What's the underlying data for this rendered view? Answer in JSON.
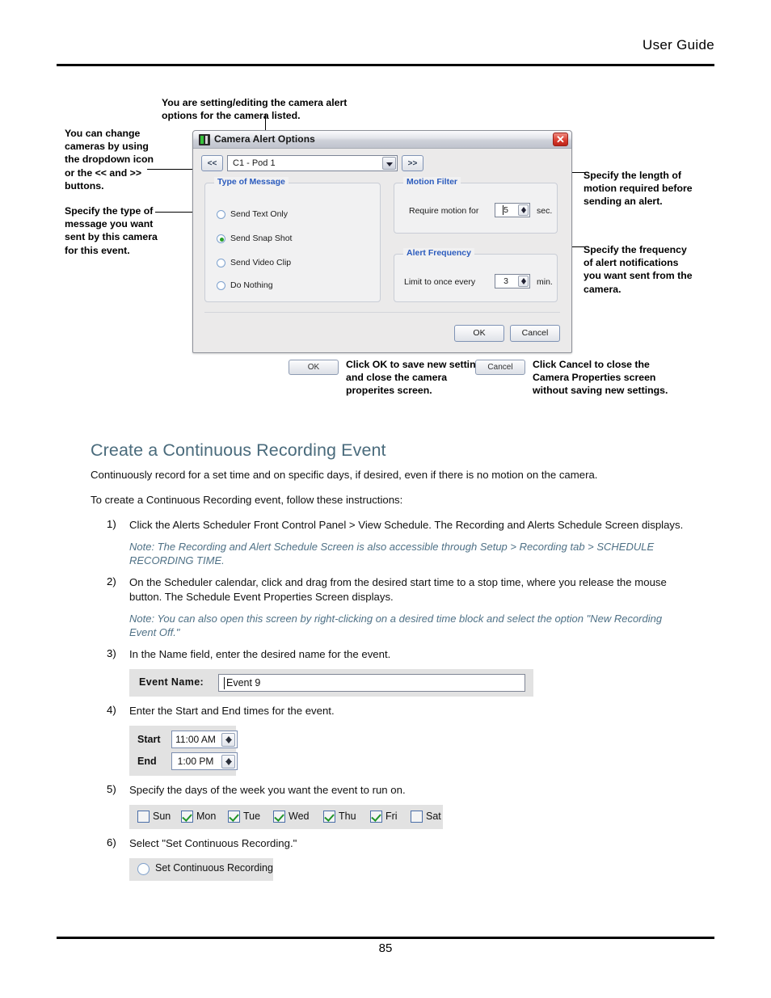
{
  "header": {
    "title": "User Guide"
  },
  "footer": {
    "page_number": "85"
  },
  "figure": {
    "callouts": {
      "top": "You are setting/editing the camera alert options for the camera listed.",
      "left_top": "You can change cameras by using the dropdown icon or the << and >> buttons.",
      "left_bottom": "Specify the type of message you want sent by this camera for this event.",
      "right_top": "Specify the length of motion required before sending an alert.",
      "right_bottom": "Specify the frequency of alert notifications you want sent from the camera.",
      "ok_caption": "Click OK to save new settings and close the camera properites screen.",
      "cancel_caption": "Click Cancel to close the Camera Properties screen without saving new settings."
    },
    "dialog": {
      "title": "Camera Alert Options",
      "close_label": "✕",
      "prev_label": "<<",
      "next_label": ">>",
      "camera_combo_value": "C1 - Pod 1",
      "type_of_message": {
        "legend": "Type of Message",
        "options": [
          {
            "label": "Send Text Only",
            "selected": false
          },
          {
            "label": "Send Snap Shot",
            "selected": true
          },
          {
            "label": "Send Video Clip",
            "selected": false
          },
          {
            "label": "Do Nothing",
            "selected": false
          }
        ]
      },
      "motion_filter": {
        "legend": "Motion Filter",
        "prefix": "Require motion for",
        "value": "5",
        "suffix": "sec."
      },
      "alert_frequency": {
        "legend": "Alert Frequency",
        "prefix": "Limit to once every",
        "value": "3",
        "suffix": "min."
      },
      "ok_label": "OK",
      "cancel_label": "Cancel"
    },
    "mini_buttons": {
      "ok_label": "OK",
      "cancel_label": "Cancel"
    }
  },
  "content": {
    "section_title": "Create a Continuous Recording Event",
    "intro": "Continuously record for a set time and on specific days, if desired, even if there is no motion on the camera.",
    "lead_in": "To create a Continuous Recording event, follow these instructions:",
    "steps": [
      {
        "num": "1)",
        "text": "Click the Alerts Scheduler Front Control Panel > View Schedule.  The Recording and Alerts Schedule Screen displays.",
        "note": "Note: The Recording and Alert Schedule Screen is also accessible through Setup > Recording tab > SCHEDULE RECORDING TIME."
      },
      {
        "num": "2)",
        "text": "On the Scheduler calendar, click and drag from the desired start time to a stop time, where you release the mouse button.  The Schedule Event Properties Screen displays.",
        "note": "Note: You can also open this screen by right-clicking on a desired time block and select the option \"New Recording Event Off.\""
      },
      {
        "num": "3)",
        "text": "In the Name field, enter the desired name for the event."
      },
      {
        "num": "4)",
        "text": "Enter the Start and End times for the event."
      },
      {
        "num": "5)",
        "text": "Specify the days of the week you want the event to run on."
      },
      {
        "num": "6)",
        "text": "Select \"Set Continuous Recording.\""
      }
    ],
    "event_name_widget": {
      "label": "Event Name:",
      "value": "Event 9"
    },
    "time_widget": {
      "start_label": "Start",
      "start_value": "11:00 AM",
      "end_label": "End",
      "end_value": "1:00 PM"
    },
    "days_widget": [
      {
        "label": "Sun",
        "checked": false
      },
      {
        "label": "Mon",
        "checked": true
      },
      {
        "label": "Tue",
        "checked": true
      },
      {
        "label": "Wed",
        "checked": true
      },
      {
        "label": "Thu",
        "checked": true
      },
      {
        "label": "Fri",
        "checked": true
      },
      {
        "label": "Sat",
        "checked": false
      }
    ],
    "continuous_widget": {
      "label": "Set Continuous Recording",
      "selected": false
    }
  },
  "colors": {
    "heading": "#4a6b7c",
    "note": "#4f7186",
    "group_legend": "#2b5bbd",
    "check_green": "#1f9427",
    "close_red": "#d8392b"
  }
}
